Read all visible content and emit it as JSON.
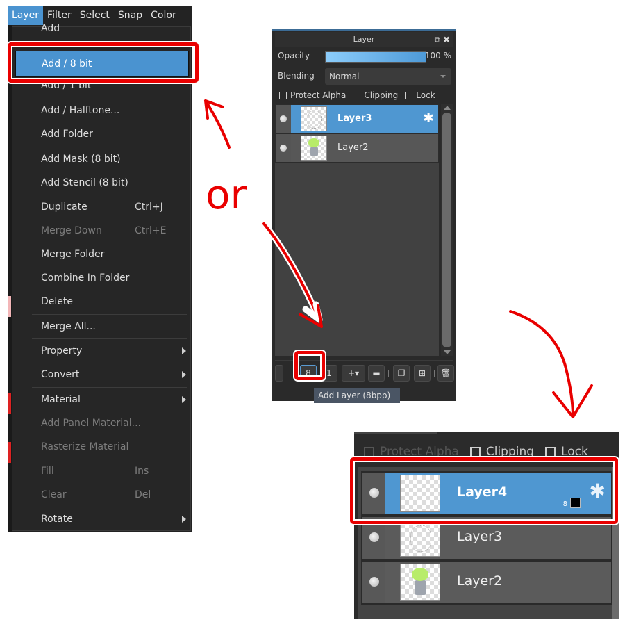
{
  "menubar": {
    "items": [
      "Layer",
      "Filter",
      "Select",
      "Snap",
      "Color"
    ],
    "active_index": 0
  },
  "layer_menu": {
    "items": [
      {
        "label": "Add",
        "shortcut": "",
        "submenu": false,
        "disabled": false,
        "partially_hidden": true
      },
      {
        "label": "Add / 8 bit",
        "shortcut": "",
        "submenu": false,
        "disabled": false,
        "selected": true
      },
      {
        "label": "Add / 1 bit",
        "shortcut": "",
        "submenu": false,
        "disabled": false,
        "partially_hidden": true
      },
      {
        "label": "Add / Halftone...",
        "shortcut": "",
        "submenu": false,
        "disabled": false
      },
      {
        "label": "Add Folder",
        "shortcut": "",
        "submenu": false,
        "disabled": false
      },
      {
        "label": "Add Mask (8 bit)",
        "shortcut": "",
        "submenu": false,
        "disabled": false
      },
      {
        "label": "Add Stencil (8 bit)",
        "shortcut": "",
        "submenu": false,
        "disabled": false
      },
      {
        "label": "Duplicate",
        "shortcut": "Ctrl+J",
        "submenu": false,
        "disabled": false
      },
      {
        "label": "Merge Down",
        "shortcut": "Ctrl+E",
        "submenu": false,
        "disabled": true
      },
      {
        "label": "Merge Folder",
        "shortcut": "",
        "submenu": false,
        "disabled": false
      },
      {
        "label": "Combine In Folder",
        "shortcut": "",
        "submenu": false,
        "disabled": false
      },
      {
        "label": "Delete",
        "shortcut": "",
        "submenu": false,
        "disabled": false
      },
      {
        "label": "Merge All...",
        "shortcut": "",
        "submenu": false,
        "disabled": false
      },
      {
        "label": "Property",
        "shortcut": "",
        "submenu": true,
        "disabled": false
      },
      {
        "label": "Convert",
        "shortcut": "",
        "submenu": true,
        "disabled": false
      },
      {
        "label": "Material",
        "shortcut": "",
        "submenu": true,
        "disabled": false
      },
      {
        "label": "Add Panel Material...",
        "shortcut": "",
        "submenu": false,
        "disabled": true
      },
      {
        "label": "Rasterize Material",
        "shortcut": "",
        "submenu": false,
        "disabled": true
      },
      {
        "label": "Fill",
        "shortcut": "Ins",
        "submenu": false,
        "disabled": true
      },
      {
        "label": "Clear",
        "shortcut": "Del",
        "submenu": false,
        "disabled": true
      },
      {
        "label": "Rotate",
        "shortcut": "",
        "submenu": true,
        "disabled": false
      }
    ]
  },
  "layer_panel": {
    "title": "Layer",
    "title_icons": [
      "undock-icon",
      "close-icon"
    ],
    "opacity_label": "Opacity",
    "opacity_value": "100 %",
    "opacity_fraction": 1.0,
    "blending_label": "Blending",
    "blending_value": "Normal",
    "checkboxes": [
      {
        "label": "Protect Alpha",
        "checked": false
      },
      {
        "label": "Clipping",
        "checked": false
      },
      {
        "label": "Lock",
        "checked": false
      }
    ],
    "layers": [
      {
        "name": "Layer3",
        "selected": true,
        "visible": true,
        "has_settings": true
      },
      {
        "name": "Layer2",
        "selected": false,
        "visible": true,
        "has_settings": false
      }
    ],
    "toolbar_buttons": [
      {
        "name": "add-layer-partial",
        "glyph": "▯"
      },
      {
        "name": "add-layer-8bpp",
        "glyph": "8",
        "highlighted": true
      },
      {
        "name": "add-layer-1bpp",
        "glyph": "1"
      },
      {
        "name": "add-layer-menu",
        "glyph": "+▾"
      },
      {
        "name": "add-folder",
        "glyph": "▬"
      },
      {
        "name": "duplicate-layer",
        "glyph": "❐"
      },
      {
        "name": "merge-layer",
        "glyph": "⊞"
      },
      {
        "name": "delete-layer",
        "glyph": "🗑"
      }
    ],
    "tooltip": "Add Layer (8bpp)"
  },
  "annotation": {
    "or_text": "or",
    "highlight_color": "#e90000"
  },
  "result_panel": {
    "checkboxes": [
      {
        "label": "Protect Alpha",
        "checked": false
      },
      {
        "label": "Clipping",
        "checked": false
      },
      {
        "label": "Lock",
        "checked": false
      }
    ],
    "layers": [
      {
        "name": "Layer4",
        "selected": true,
        "bit_depth": "8",
        "has_settings": true
      },
      {
        "name": "Layer3",
        "selected": false
      },
      {
        "name": "Layer2",
        "selected": false
      }
    ]
  }
}
